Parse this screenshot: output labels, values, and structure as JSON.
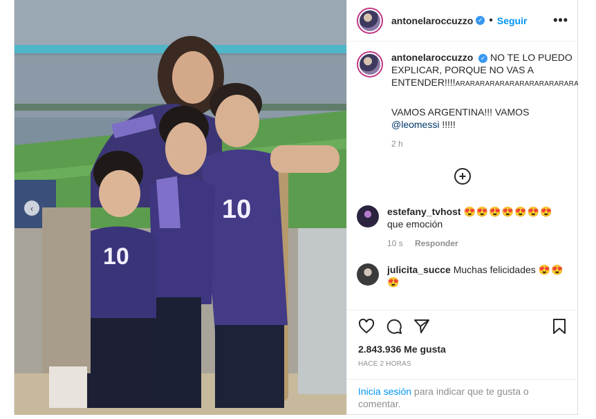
{
  "post": {
    "username": "antonelaroccuzzo",
    "follow_label": "Seguir",
    "more_label": "•••",
    "separator": "•",
    "caption": {
      "username": "antonelaroccuzzo",
      "line1": "NO TE LO PUEDO EXPLICAR, PORQUE NO VAS A ENTENDER!!!!",
      "line1_small": "ARARARARARARARARARARARARARARAR",
      "line2": "VAMOS ARGENTINA!!! VAMOS",
      "mention": "@leomessi",
      "line2_end": " !!!!!",
      "time": "2 h"
    },
    "load_more_icon": "+",
    "comments": [
      {
        "username": "estefany_tvhost",
        "text": "que emoción",
        "emoji": "😍😍😍😍😍😍😍",
        "time": "10 s",
        "reply": "Responder"
      },
      {
        "username": "julicita_succe",
        "text": "Muchas felicidades",
        "emoji": "😍😍😍"
      }
    ],
    "likes": "2.843.936 Me gusta",
    "posted": "HACE 2 HORAS",
    "login_link": "Inicia sesión",
    "login_rest": " para indicar que te gusta o comentar."
  },
  "icons": {
    "heart": "heart-icon",
    "comment": "comment-icon",
    "share": "share-icon",
    "save": "bookmark-icon",
    "verified": "verified-icon"
  },
  "colors": {
    "link": "#0095f6",
    "verified": "#3897f0",
    "jersey": "#4a3f8c"
  }
}
